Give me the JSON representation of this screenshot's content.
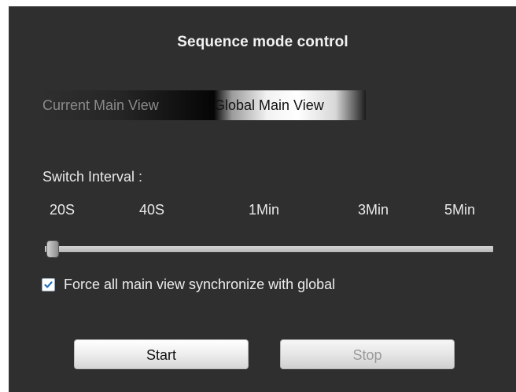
{
  "panel": {
    "title": "Sequence mode control"
  },
  "tabs": {
    "current": "Current Main View",
    "global": "Global Main View",
    "selected": "Global Main View"
  },
  "interval": {
    "label": "Switch Interval :",
    "ticks": [
      "20S",
      "40S",
      "1Min",
      "3Min",
      "5Min"
    ],
    "selected": "20S"
  },
  "sync": {
    "label": "Force all main view synchronize with global",
    "checked": true
  },
  "buttons": {
    "start": "Start",
    "stop": "Stop",
    "stop_enabled": false
  },
  "colors": {
    "panel_bg": "#2f2f2f",
    "text": "#eaeaea",
    "checkbox_check": "#2a6ebd",
    "disabled_text": "#9a9a9a"
  }
}
